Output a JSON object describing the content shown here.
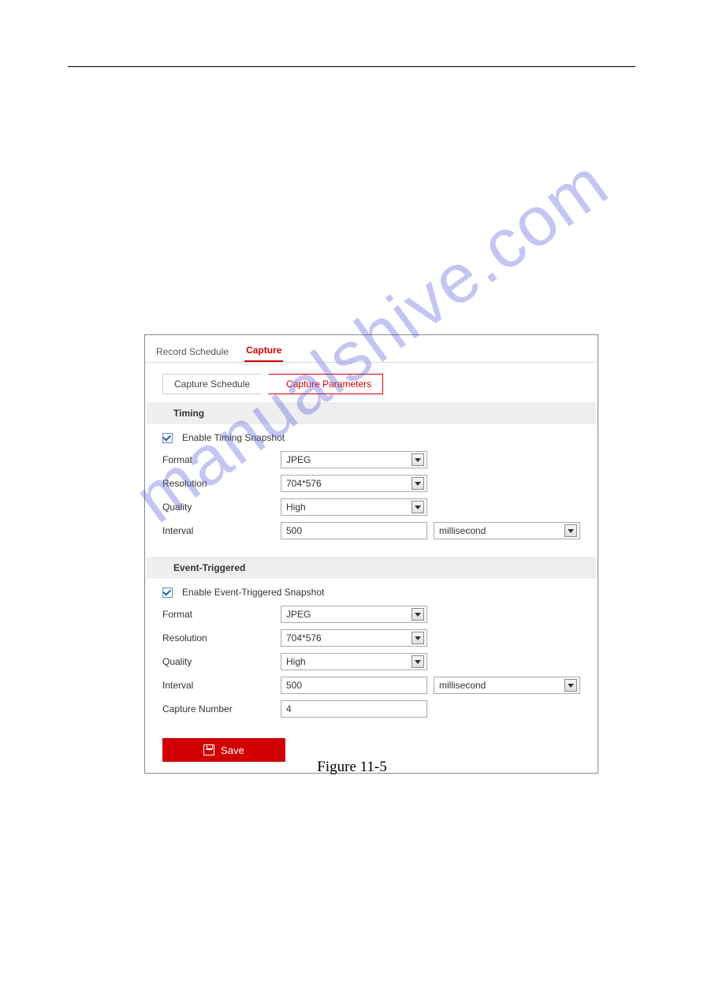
{
  "watermark": "manualshive.com",
  "caption": "Figure 11-5",
  "tabs": {
    "record_schedule": "Record Schedule",
    "capture": "Capture"
  },
  "subtabs": {
    "capture_schedule": "Capture Schedule",
    "capture_parameters": "Capture Parameters"
  },
  "timing": {
    "header": "Timing",
    "enable_label": "Enable Timing Snapshot",
    "enable_checked": true,
    "format_label": "Format",
    "format_value": "JPEG",
    "resolution_label": "Resolution",
    "resolution_value": "704*576",
    "quality_label": "Quality",
    "quality_value": "High",
    "interval_label": "Interval",
    "interval_value": "500",
    "interval_unit": "millisecond"
  },
  "event": {
    "header": "Event-Triggered",
    "enable_label": "Enable Event-Triggered Snapshot",
    "enable_checked": true,
    "format_label": "Format",
    "format_value": "JPEG",
    "resolution_label": "Resolution",
    "resolution_value": "704*576",
    "quality_label": "Quality",
    "quality_value": "High",
    "interval_label": "Interval",
    "interval_value": "500",
    "interval_unit": "millisecond",
    "capture_number_label": "Capture Number",
    "capture_number_value": "4"
  },
  "save_label": "Save"
}
